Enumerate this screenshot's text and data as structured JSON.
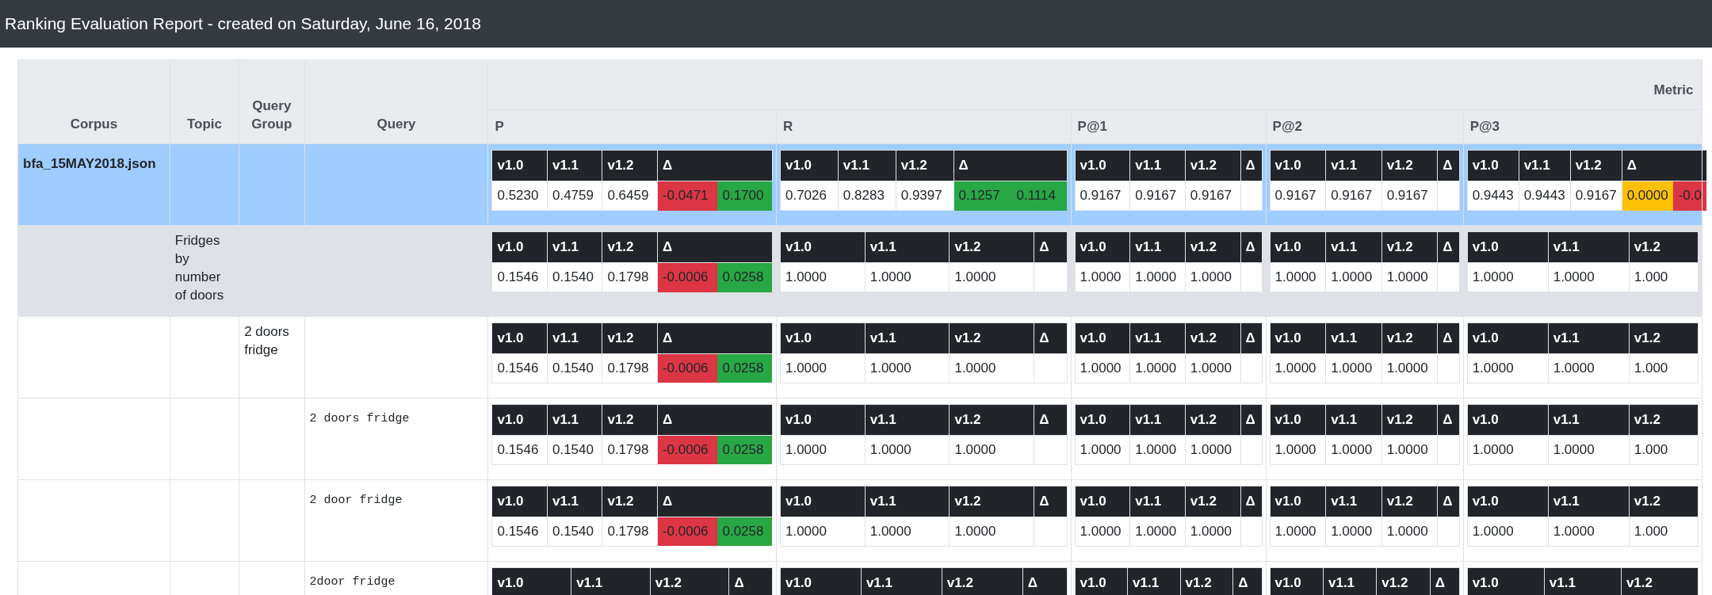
{
  "title": "Ranking Evaluation Report - created on Saturday, June 16, 2018",
  "columns": [
    "Corpus",
    "Topic",
    "Query Group",
    "Query"
  ],
  "metric_group": "Metric",
  "metrics": [
    "P",
    "R",
    "P@1",
    "P@2",
    "P@3"
  ],
  "rows": [
    {
      "kind": "corpus",
      "text": "bfa_15MAY2018.json",
      "cells": [
        {
          "headers": [
            "v1.0",
            "v1.1",
            "v1.2",
            "Δ"
          ],
          "values": [
            "0.5230",
            "0.4759",
            "0.6459"
          ],
          "deltas": [
            {
              "text": "-0.0471",
              "color": "#dc3545"
            },
            {
              "text": "0.1700",
              "color": "#28a745"
            }
          ]
        },
        {
          "headers": [
            "v1.0",
            "v1.1",
            "v1.2",
            "Δ"
          ],
          "values": [
            "0.7026",
            "0.8283",
            "0.9397"
          ],
          "deltas": [
            {
              "text": "0.1257",
              "color": "#28a745"
            },
            {
              "text": "0.1114",
              "color": "#28a745"
            }
          ]
        },
        {
          "headers": [
            "v1.0",
            "v1.1",
            "v1.2",
            "Δ"
          ],
          "values": [
            "0.9167",
            "0.9167",
            "0.9167"
          ]
        },
        {
          "headers": [
            "v1.0",
            "v1.1",
            "v1.2",
            "Δ"
          ],
          "values": [
            "0.9167",
            "0.9167",
            "0.9167"
          ]
        },
        {
          "headers": [
            "v1.0",
            "v1.1",
            "v1.2",
            "Δ"
          ],
          "values": [
            "0.9443",
            "0.9443",
            "0.9167"
          ],
          "deltas": [
            {
              "text": "0.0000",
              "color": "#ffc107"
            },
            {
              "text": "-0.0",
              "color": "#dc3545"
            }
          ]
        }
      ]
    },
    {
      "kind": "topic",
      "text": "Fridges by number of doors",
      "cells": [
        {
          "headers": [
            "v1.0",
            "v1.1",
            "v1.2",
            "Δ"
          ],
          "values": [
            "0.1546",
            "0.1540",
            "0.1798"
          ],
          "deltas": [
            {
              "text": "-0.0006",
              "color": "#dc3545"
            },
            {
              "text": "0.0258",
              "color": "#28a745"
            }
          ]
        },
        {
          "headers": [
            "v1.0",
            "v1.1",
            "v1.2",
            "Δ"
          ],
          "values": [
            "1.0000",
            "1.0000",
            "1.0000"
          ]
        },
        {
          "headers": [
            "v1.0",
            "v1.1",
            "v1.2",
            "Δ"
          ],
          "values": [
            "1.0000",
            "1.0000",
            "1.0000"
          ]
        },
        {
          "headers": [
            "v1.0",
            "v1.1",
            "v1.2",
            "Δ"
          ],
          "values": [
            "1.0000",
            "1.0000",
            "1.0000"
          ]
        },
        {
          "headers": [
            "v1.0",
            "v1.1",
            "v1.2"
          ],
          "values": [
            "1.0000",
            "1.0000",
            "1.000"
          ]
        }
      ]
    },
    {
      "kind": "group",
      "text": "2 doors fridge",
      "cells": [
        {
          "headers": [
            "v1.0",
            "v1.1",
            "v1.2",
            "Δ"
          ],
          "values": [
            "0.1546",
            "0.1540",
            "0.1798"
          ],
          "deltas": [
            {
              "text": "-0.0006",
              "color": "#dc3545"
            },
            {
              "text": "0.0258",
              "color": "#28a745"
            }
          ]
        },
        {
          "headers": [
            "v1.0",
            "v1.1",
            "v1.2",
            "Δ"
          ],
          "values": [
            "1.0000",
            "1.0000",
            "1.0000"
          ]
        },
        {
          "headers": [
            "v1.0",
            "v1.1",
            "v1.2",
            "Δ"
          ],
          "values": [
            "1.0000",
            "1.0000",
            "1.0000"
          ]
        },
        {
          "headers": [
            "v1.0",
            "v1.1",
            "v1.2",
            "Δ"
          ],
          "values": [
            "1.0000",
            "1.0000",
            "1.0000"
          ]
        },
        {
          "headers": [
            "v1.0",
            "v1.1",
            "v1.2"
          ],
          "values": [
            "1.0000",
            "1.0000",
            "1.000"
          ]
        }
      ]
    },
    {
      "kind": "query",
      "text": "2 doors fridge",
      "cells": [
        {
          "headers": [
            "v1.0",
            "v1.1",
            "v1.2",
            "Δ"
          ],
          "values": [
            "0.1546",
            "0.1540",
            "0.1798"
          ],
          "deltas": [
            {
              "text": "-0.0006",
              "color": "#dc3545"
            },
            {
              "text": "0.0258",
              "color": "#28a745"
            }
          ]
        },
        {
          "headers": [
            "v1.0",
            "v1.1",
            "v1.2",
            "Δ"
          ],
          "values": [
            "1.0000",
            "1.0000",
            "1.0000"
          ]
        },
        {
          "headers": [
            "v1.0",
            "v1.1",
            "v1.2",
            "Δ"
          ],
          "values": [
            "1.0000",
            "1.0000",
            "1.0000"
          ]
        },
        {
          "headers": [
            "v1.0",
            "v1.1",
            "v1.2",
            "Δ"
          ],
          "values": [
            "1.0000",
            "1.0000",
            "1.0000"
          ]
        },
        {
          "headers": [
            "v1.0",
            "v1.1",
            "v1.2"
          ],
          "values": [
            "1.0000",
            "1.0000",
            "1.000"
          ]
        }
      ]
    },
    {
      "kind": "query",
      "text": "2 door fridge",
      "cells": [
        {
          "headers": [
            "v1.0",
            "v1.1",
            "v1.2",
            "Δ"
          ],
          "values": [
            "0.1546",
            "0.1540",
            "0.1798"
          ],
          "deltas": [
            {
              "text": "-0.0006",
              "color": "#dc3545"
            },
            {
              "text": "0.0258",
              "color": "#28a745"
            }
          ]
        },
        {
          "headers": [
            "v1.0",
            "v1.1",
            "v1.2",
            "Δ"
          ],
          "values": [
            "1.0000",
            "1.0000",
            "1.0000"
          ]
        },
        {
          "headers": [
            "v1.0",
            "v1.1",
            "v1.2",
            "Δ"
          ],
          "values": [
            "1.0000",
            "1.0000",
            "1.0000"
          ]
        },
        {
          "headers": [
            "v1.0",
            "v1.1",
            "v1.2",
            "Δ"
          ],
          "values": [
            "1.0000",
            "1.0000",
            "1.0000"
          ]
        },
        {
          "headers": [
            "v1.0",
            "v1.1",
            "v1.2"
          ],
          "values": [
            "1.0000",
            "1.0000",
            "1.000"
          ]
        }
      ]
    },
    {
      "kind": "query",
      "text": "2door fridge",
      "cells": [
        {
          "headers": [
            "v1.0",
            "v1.1",
            "v1.2",
            "Δ"
          ]
        },
        {
          "headers": [
            "v1.0",
            "v1.1",
            "v1.2",
            "Δ"
          ]
        },
        {
          "headers": [
            "v1.0",
            "v1.1",
            "v1.2",
            "Δ"
          ]
        },
        {
          "headers": [
            "v1.0",
            "v1.1",
            "v1.2",
            "Δ"
          ]
        },
        {
          "headers": [
            "v1.0",
            "v1.1",
            "v1.2"
          ]
        }
      ]
    }
  ]
}
